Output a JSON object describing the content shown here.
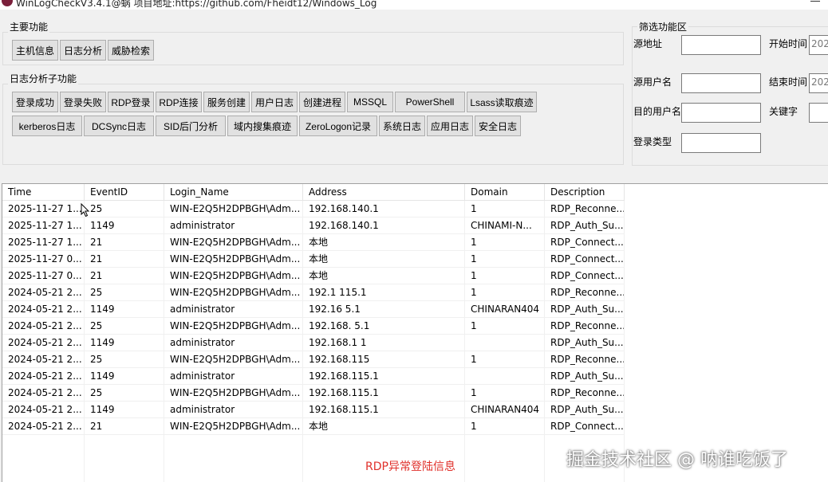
{
  "window": {
    "title": "WinLogCheckV3.4.1@蜗 项目地址:https://github.com/Fheidt12/Windows_Log"
  },
  "main_functions": {
    "title": "主要功能",
    "buttons": [
      "主机信息",
      "日志分析",
      "威胁检索"
    ]
  },
  "sub_functions": {
    "title": "日志分析子功能",
    "row1": [
      "登录成功",
      "登录失败",
      "RDP登录",
      "RDP连接",
      "服务创建",
      "用户日志",
      "创建进程",
      "MSSQL",
      "PowerShell",
      "Lsass读取痕迹"
    ],
    "row2": [
      "kerberos日志",
      "DCSync日志",
      "SID后门分析",
      "域内搜集痕迹",
      "ZeroLogon记录",
      "系统日志",
      "应用日志",
      "安全日志"
    ]
  },
  "filter": {
    "title": "筛选功能区",
    "source_address_label": "源地址",
    "source_user_label": "源用户名",
    "target_user_label": "目的用户名",
    "logon_type_label": "登录类型",
    "start_time_label": "开始时间",
    "end_time_label": "结束时间",
    "keyword_label": "关键字",
    "start_time_value": "202",
    "end_time_value": "202"
  },
  "table": {
    "columns": [
      "Time",
      "EventID",
      "Login_Name",
      "Address",
      "Domain",
      "Description"
    ],
    "rows": [
      [
        "2025-11-27 1...",
        "25",
        "WIN-E2Q5H2DPBGH\\Adm...",
        "192.168.140.1",
        "1",
        "RDP_Reconne..."
      ],
      [
        "2025-11-27 1...",
        "1149",
        "administrator",
        "192.168.140.1",
        "CHINAMI-N...",
        "RDP_Auth_Su..."
      ],
      [
        "2025-11-27 1...",
        "21",
        "WIN-E2Q5H2DPBGH\\Adm...",
        "本地",
        "1",
        "RDP_Connect..."
      ],
      [
        "2025-11-27 0...",
        "21",
        "WIN-E2Q5H2DPBGH\\Adm...",
        "本地",
        "1",
        "RDP_Connect..."
      ],
      [
        "2025-11-27 0...",
        "21",
        "WIN-E2Q5H2DPBGH\\Adm...",
        "本地",
        "1",
        "RDP_Connect..."
      ],
      [
        "2024-05-21 2...",
        "25",
        "WIN-E2Q5H2DPBGH\\Adm...",
        "192.1  115.1",
        "1",
        "RDP_Reconne..."
      ],
      [
        "2024-05-21 2...",
        "1149",
        "administrator",
        "192.16  5.1",
        "CHINARAN404",
        "RDP_Auth_Su..."
      ],
      [
        "2024-05-21 2...",
        "25",
        "WIN-E2Q5H2DPBGH\\Adm...",
        "192.168.  5.1",
        "1",
        "RDP_Reconne..."
      ],
      [
        "2024-05-21 2...",
        "1149",
        "administrator",
        "192.168.1  1",
        "",
        "RDP_Auth_Su..."
      ],
      [
        "2024-05-21 2...",
        "25",
        "WIN-E2Q5H2DPBGH\\Adm...",
        "192.168.115",
        "1",
        "RDP_Reconne..."
      ],
      [
        "2024-05-21 2...",
        "1149",
        "administrator",
        "192.168.115.1",
        "",
        "RDP_Auth_Su..."
      ],
      [
        "2024-05-21 2...",
        "25",
        "WIN-E2Q5H2DPBGH\\Adm...",
        "192.168.115.1",
        "1",
        "RDP_Reconne..."
      ],
      [
        "2024-05-21 2...",
        "1149",
        "administrator",
        "192.168.115.1",
        "CHINARAN404",
        "RDP_Auth_Su..."
      ],
      [
        "2024-05-21 2...",
        "21",
        "WIN-E2Q5H2DPBGH\\Adm...",
        "本地",
        "1",
        "RDP_Connect..."
      ]
    ]
  },
  "caption": "RDP异常登陆信息",
  "watermark": "掘金技术社区 @ 呐谁吃饭了"
}
